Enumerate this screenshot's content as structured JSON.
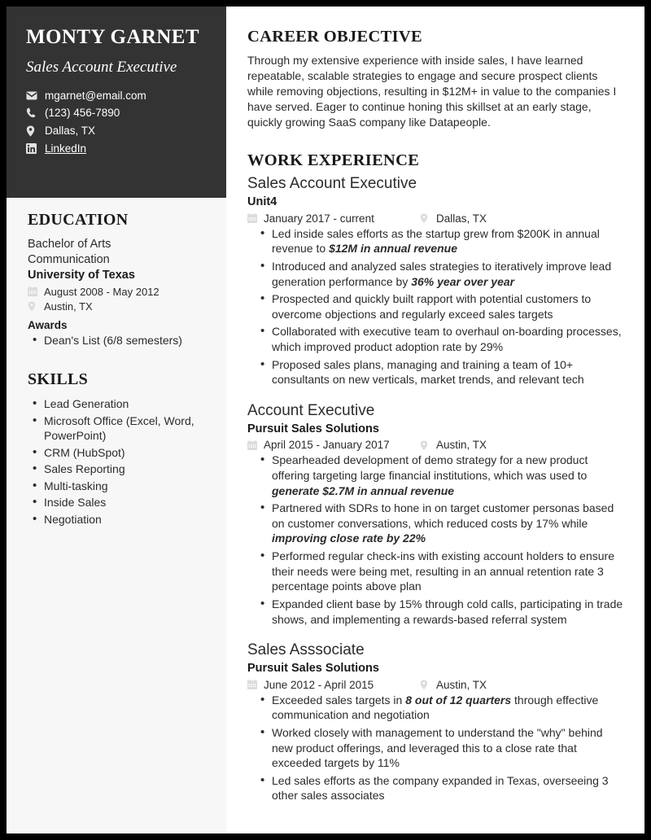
{
  "colors": {
    "header_bg": "#333333",
    "sidebar_bg": "#f7f7f7",
    "main_bg": "#ffffff",
    "page_border": "#000000",
    "text": "#2b2b2b",
    "heading": "#1a1a1a",
    "icon_muted": "#d9d9d9"
  },
  "header": {
    "name": "MONTY GARNET",
    "job_title": "Sales Account Executive",
    "contacts": [
      {
        "icon": "envelope-icon",
        "label": "mgarnet@email.com",
        "link": false
      },
      {
        "icon": "phone-icon",
        "label": "(123) 456-7890",
        "link": false
      },
      {
        "icon": "location-pin-icon",
        "label": "Dallas, TX",
        "link": false
      },
      {
        "icon": "linkedin-icon",
        "label": "LinkedIn",
        "link": true
      }
    ]
  },
  "education": {
    "heading": "EDUCATION",
    "degree_line1": "Bachelor of Arts",
    "degree_line2": "Communication",
    "school": "University of Texas",
    "dates": "August 2008 - May 2012",
    "location": "Austin, TX",
    "awards_label": "Awards",
    "awards": [
      "Dean's List (6/8 semesters)"
    ]
  },
  "skills": {
    "heading": "SKILLS",
    "items": [
      "Lead Generation",
      "Microsoft Office (Excel, Word, PowerPoint)",
      "CRM (HubSpot)",
      "Sales Reporting",
      "Multi-tasking",
      "Inside Sales",
      "Negotiation"
    ]
  },
  "objective": {
    "heading": "CAREER OBJECTIVE",
    "text": "Through my extensive experience with inside sales, I have learned repeatable, scalable strategies to engage and secure prospect clients while removing objections, resulting in $12M+ in value to the companies I have served. Eager to continue honing this skillset at an early stage, quickly growing SaaS company like Datapeople."
  },
  "work": {
    "heading": "WORK EXPERIENCE",
    "jobs": [
      {
        "role": "Sales Account Executive",
        "company": "Unit4",
        "dates": "January 2017 - current",
        "location": "Dallas, TX",
        "bullets": [
          {
            "pre": "Led inside sales efforts as the startup grew from $200K in annual revenue to ",
            "em": "$12M in annual revenue",
            "post": ""
          },
          {
            "pre": "Introduced and analyzed sales strategies to iteratively improve lead generation performance by ",
            "em": "36% year over year",
            "post": ""
          },
          {
            "pre": "Prospected and quickly built rapport with potential customers to overcome objections and regularly exceed sales targets",
            "em": "",
            "post": ""
          },
          {
            "pre": "Collaborated with executive team to overhaul on-boarding processes, which improved product adoption rate by 29%",
            "em": "",
            "post": ""
          },
          {
            "pre": "Proposed sales plans, managing and training a team of 10+ consultants on new verticals, market trends, and relevant tech",
            "em": "",
            "post": ""
          }
        ]
      },
      {
        "role": "Account Executive",
        "company": "Pursuit Sales Solutions",
        "dates": "April 2015 - January 2017",
        "location": "Austin, TX",
        "bullets": [
          {
            "pre": "Spearheaded development of demo strategy for a new product offering targeting large financial institutions, which was used to ",
            "em": "generate $2.7M in annual revenue",
            "post": ""
          },
          {
            "pre": "Partnered with SDRs to hone in on target customer personas based on customer conversations, which reduced costs by 17% while ",
            "em": "improving close rate by 22%",
            "post": ""
          },
          {
            "pre": "Performed regular check-ins with existing account holders to ensure their needs were being met, resulting in an annual retention rate 3 percentage points above plan",
            "em": "",
            "post": ""
          },
          {
            "pre": "Expanded client base by 15% through cold calls, participating in trade shows, and implementing a rewards-based referral system",
            "em": "",
            "post": ""
          }
        ]
      },
      {
        "role": "Sales Asssociate",
        "company": "Pursuit Sales Solutions",
        "dates": "June 2012 - April 2015",
        "location": "Austin, TX",
        "bullets": [
          {
            "pre": "Exceeded sales targets in ",
            "em": "8 out of 12 quarters",
            "post": " through effective communication and negotiation"
          },
          {
            "pre": "Worked closely with management to understand the \"why\" behind new product offerings, and leveraged this to a close rate that exceeded targets by 11%",
            "em": "",
            "post": ""
          },
          {
            "pre": "Led sales efforts as the company expanded in Texas, overseeing 3 other sales associates",
            "em": "",
            "post": ""
          }
        ]
      }
    ]
  }
}
